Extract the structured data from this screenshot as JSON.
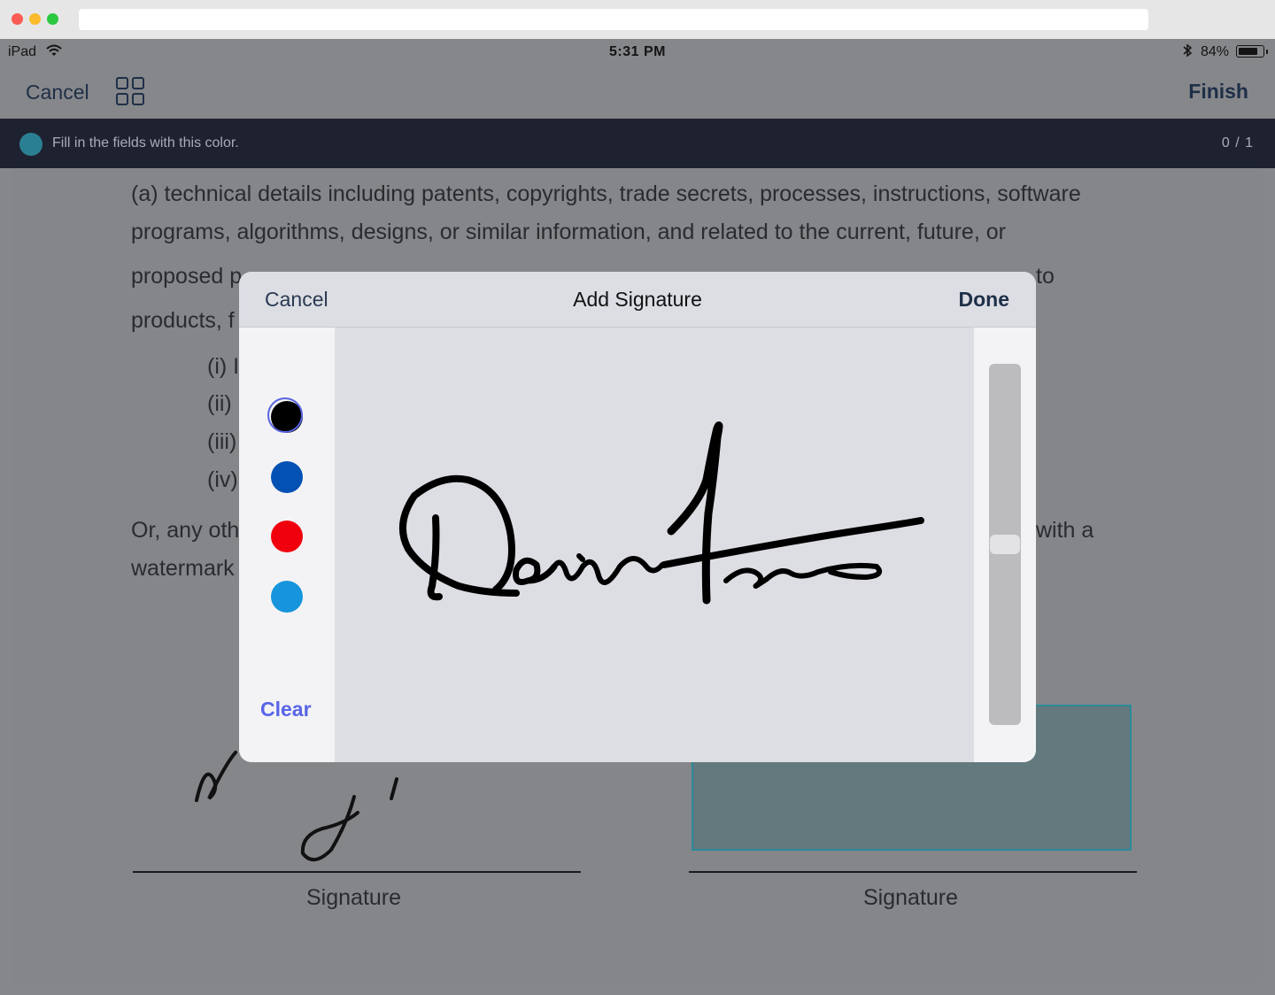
{
  "status_bar": {
    "device": "iPad",
    "time": "5:31 PM",
    "battery": "84%",
    "battery_level": 0.84,
    "icons": [
      "wifi-icon",
      "bluetooth-icon",
      "battery-icon"
    ]
  },
  "nav": {
    "cancel_label": "Cancel",
    "finish_label": "Finish",
    "icons": [
      "grid-icon"
    ]
  },
  "banner": {
    "text": "Fill in the fields with this color.",
    "count": "0 / 1",
    "color": "#2b7f92"
  },
  "document": {
    "lines": [
      "(a) technical details including patents, copyrights, trade secrets, processes, instructions, software",
      "programs, algorithms, designs, or similar information, and related to the current, future, or",
      "proposed p",
      "to",
      "products, f",
      "(i) I",
      "(ii)",
      "(iii)",
      "(iv)",
      "Or, any oth",
      "with a",
      "watermark"
    ],
    "signature_labels": [
      "Signature",
      "Signature"
    ],
    "field_color": "#2b8a99"
  },
  "modal": {
    "cancel_label": "Cancel",
    "title": "Add Signature",
    "done_label": "Done",
    "clear_label": "Clear",
    "colors": [
      {
        "name": "black",
        "hex": "#000000",
        "selected": true
      },
      {
        "name": "blue",
        "hex": "#0351b3",
        "selected": false
      },
      {
        "name": "red",
        "hex": "#f0000d",
        "selected": false
      },
      {
        "name": "light-blue",
        "hex": "#1695dc",
        "selected": false
      }
    ],
    "slider_value": 0.5
  }
}
